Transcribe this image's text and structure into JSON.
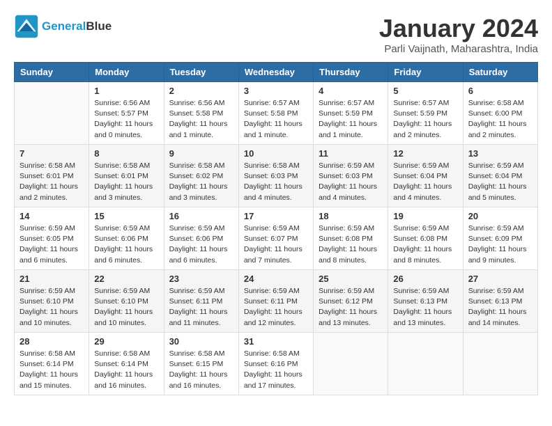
{
  "header": {
    "logo_line1": "General",
    "logo_line2": "Blue",
    "month": "January 2024",
    "location": "Parli Vaijnath, Maharashtra, India"
  },
  "weekdays": [
    "Sunday",
    "Monday",
    "Tuesday",
    "Wednesday",
    "Thursday",
    "Friday",
    "Saturday"
  ],
  "weeks": [
    [
      {
        "day": "",
        "sunrise": "",
        "sunset": "",
        "daylight": ""
      },
      {
        "day": "1",
        "sunrise": "Sunrise: 6:56 AM",
        "sunset": "Sunset: 5:57 PM",
        "daylight": "Daylight: 11 hours and 0 minutes."
      },
      {
        "day": "2",
        "sunrise": "Sunrise: 6:56 AM",
        "sunset": "Sunset: 5:58 PM",
        "daylight": "Daylight: 11 hours and 1 minute."
      },
      {
        "day": "3",
        "sunrise": "Sunrise: 6:57 AM",
        "sunset": "Sunset: 5:58 PM",
        "daylight": "Daylight: 11 hours and 1 minute."
      },
      {
        "day": "4",
        "sunrise": "Sunrise: 6:57 AM",
        "sunset": "Sunset: 5:59 PM",
        "daylight": "Daylight: 11 hours and 1 minute."
      },
      {
        "day": "5",
        "sunrise": "Sunrise: 6:57 AM",
        "sunset": "Sunset: 5:59 PM",
        "daylight": "Daylight: 11 hours and 2 minutes."
      },
      {
        "day": "6",
        "sunrise": "Sunrise: 6:58 AM",
        "sunset": "Sunset: 6:00 PM",
        "daylight": "Daylight: 11 hours and 2 minutes."
      }
    ],
    [
      {
        "day": "7",
        "sunrise": "Sunrise: 6:58 AM",
        "sunset": "Sunset: 6:01 PM",
        "daylight": "Daylight: 11 hours and 2 minutes."
      },
      {
        "day": "8",
        "sunrise": "Sunrise: 6:58 AM",
        "sunset": "Sunset: 6:01 PM",
        "daylight": "Daylight: 11 hours and 3 minutes."
      },
      {
        "day": "9",
        "sunrise": "Sunrise: 6:58 AM",
        "sunset": "Sunset: 6:02 PM",
        "daylight": "Daylight: 11 hours and 3 minutes."
      },
      {
        "day": "10",
        "sunrise": "Sunrise: 6:58 AM",
        "sunset": "Sunset: 6:03 PM",
        "daylight": "Daylight: 11 hours and 4 minutes."
      },
      {
        "day": "11",
        "sunrise": "Sunrise: 6:59 AM",
        "sunset": "Sunset: 6:03 PM",
        "daylight": "Daylight: 11 hours and 4 minutes."
      },
      {
        "day": "12",
        "sunrise": "Sunrise: 6:59 AM",
        "sunset": "Sunset: 6:04 PM",
        "daylight": "Daylight: 11 hours and 4 minutes."
      },
      {
        "day": "13",
        "sunrise": "Sunrise: 6:59 AM",
        "sunset": "Sunset: 6:04 PM",
        "daylight": "Daylight: 11 hours and 5 minutes."
      }
    ],
    [
      {
        "day": "14",
        "sunrise": "Sunrise: 6:59 AM",
        "sunset": "Sunset: 6:05 PM",
        "daylight": "Daylight: 11 hours and 6 minutes."
      },
      {
        "day": "15",
        "sunrise": "Sunrise: 6:59 AM",
        "sunset": "Sunset: 6:06 PM",
        "daylight": "Daylight: 11 hours and 6 minutes."
      },
      {
        "day": "16",
        "sunrise": "Sunrise: 6:59 AM",
        "sunset": "Sunset: 6:06 PM",
        "daylight": "Daylight: 11 hours and 6 minutes."
      },
      {
        "day": "17",
        "sunrise": "Sunrise: 6:59 AM",
        "sunset": "Sunset: 6:07 PM",
        "daylight": "Daylight: 11 hours and 7 minutes."
      },
      {
        "day": "18",
        "sunrise": "Sunrise: 6:59 AM",
        "sunset": "Sunset: 6:08 PM",
        "daylight": "Daylight: 11 hours and 8 minutes."
      },
      {
        "day": "19",
        "sunrise": "Sunrise: 6:59 AM",
        "sunset": "Sunset: 6:08 PM",
        "daylight": "Daylight: 11 hours and 8 minutes."
      },
      {
        "day": "20",
        "sunrise": "Sunrise: 6:59 AM",
        "sunset": "Sunset: 6:09 PM",
        "daylight": "Daylight: 11 hours and 9 minutes."
      }
    ],
    [
      {
        "day": "21",
        "sunrise": "Sunrise: 6:59 AM",
        "sunset": "Sunset: 6:10 PM",
        "daylight": "Daylight: 11 hours and 10 minutes."
      },
      {
        "day": "22",
        "sunrise": "Sunrise: 6:59 AM",
        "sunset": "Sunset: 6:10 PM",
        "daylight": "Daylight: 11 hours and 10 minutes."
      },
      {
        "day": "23",
        "sunrise": "Sunrise: 6:59 AM",
        "sunset": "Sunset: 6:11 PM",
        "daylight": "Daylight: 11 hours and 11 minutes."
      },
      {
        "day": "24",
        "sunrise": "Sunrise: 6:59 AM",
        "sunset": "Sunset: 6:11 PM",
        "daylight": "Daylight: 11 hours and 12 minutes."
      },
      {
        "day": "25",
        "sunrise": "Sunrise: 6:59 AM",
        "sunset": "Sunset: 6:12 PM",
        "daylight": "Daylight: 11 hours and 13 minutes."
      },
      {
        "day": "26",
        "sunrise": "Sunrise: 6:59 AM",
        "sunset": "Sunset: 6:13 PM",
        "daylight": "Daylight: 11 hours and 13 minutes."
      },
      {
        "day": "27",
        "sunrise": "Sunrise: 6:59 AM",
        "sunset": "Sunset: 6:13 PM",
        "daylight": "Daylight: 11 hours and 14 minutes."
      }
    ],
    [
      {
        "day": "28",
        "sunrise": "Sunrise: 6:58 AM",
        "sunset": "Sunset: 6:14 PM",
        "daylight": "Daylight: 11 hours and 15 minutes."
      },
      {
        "day": "29",
        "sunrise": "Sunrise: 6:58 AM",
        "sunset": "Sunset: 6:14 PM",
        "daylight": "Daylight: 11 hours and 16 minutes."
      },
      {
        "day": "30",
        "sunrise": "Sunrise: 6:58 AM",
        "sunset": "Sunset: 6:15 PM",
        "daylight": "Daylight: 11 hours and 16 minutes."
      },
      {
        "day": "31",
        "sunrise": "Sunrise: 6:58 AM",
        "sunset": "Sunset: 6:16 PM",
        "daylight": "Daylight: 11 hours and 17 minutes."
      },
      {
        "day": "",
        "sunrise": "",
        "sunset": "",
        "daylight": ""
      },
      {
        "day": "",
        "sunrise": "",
        "sunset": "",
        "daylight": ""
      },
      {
        "day": "",
        "sunrise": "",
        "sunset": "",
        "daylight": ""
      }
    ]
  ]
}
